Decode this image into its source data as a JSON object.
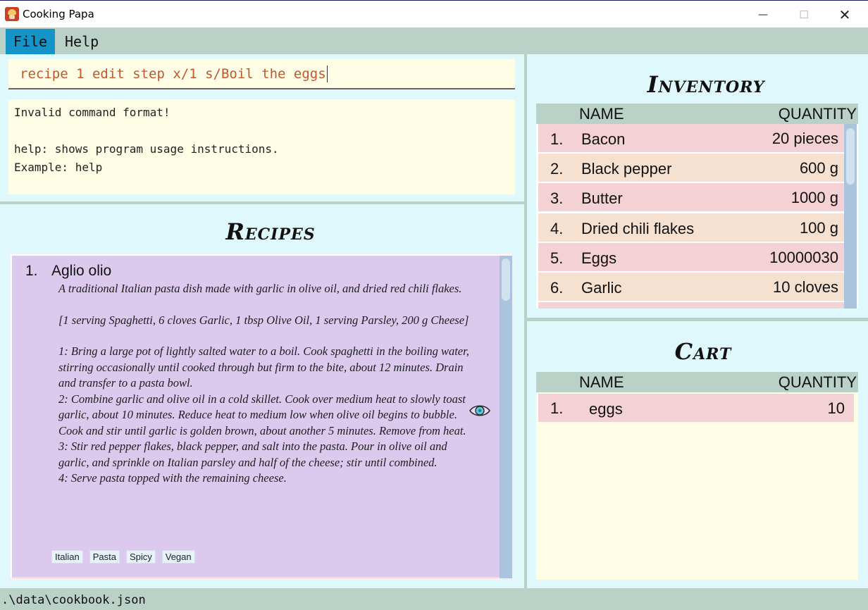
{
  "window": {
    "title": "Cooking Papa",
    "minimize_glyph": "—",
    "maximize_glyph": "☐",
    "close_glyph": "✕"
  },
  "menu": {
    "file": "File",
    "help": "Help"
  },
  "command": {
    "value": "recipe 1 edit step x/1 s/Boil the eggs"
  },
  "result": {
    "text": "Invalid command format!\n\nhelp: shows program usage instructions.\nExample: help"
  },
  "recipes": {
    "title": "Recipes",
    "items": [
      {
        "index": "1.",
        "name": "Aglio olio",
        "description": "A traditional Italian pasta dish made with garlic in olive oil, and dried red chili flakes.",
        "ingredients": "[1 serving Spaghetti, 6 cloves Garlic, 1 tbsp Olive Oil, 1 serving Parsley, 200 g Cheese]",
        "steps": [
          "1: Bring a large pot of lightly salted water to a boil. Cook spaghetti in the boiling water, stirring occasionally until cooked through but firm to the bite, about 12 minutes. Drain and transfer to a pasta bowl.",
          "2: Combine garlic and olive oil in a cold skillet. Cook over medium heat to slowly toast garlic, about 10 minutes. Reduce heat to medium low when olive oil begins to bubble. Cook and stir until garlic is golden brown, about another 5 minutes. Remove from heat.",
          "3: Stir red pepper flakes, black pepper, and salt into the pasta. Pour in olive oil and garlic, and sprinkle on Italian parsley and half of the cheese; stir until combined.",
          "4: Serve pasta topped with the remaining cheese."
        ],
        "tags": [
          "Italian",
          "Pasta",
          "Spicy",
          "Vegan"
        ],
        "icon": "eye-icon"
      }
    ]
  },
  "inventory": {
    "title": "Inventory",
    "header": {
      "name": "NAME",
      "quantity": "QUANTITY"
    },
    "rows": [
      {
        "index": "1.",
        "name": "Bacon",
        "quantity": "20 pieces"
      },
      {
        "index": "2.",
        "name": "Black pepper",
        "quantity": "600 g"
      },
      {
        "index": "3.",
        "name": "Butter",
        "quantity": "1000 g"
      },
      {
        "index": "4.",
        "name": "Dried chili flakes",
        "quantity": "100 g"
      },
      {
        "index": "5.",
        "name": "Eggs",
        "quantity": "10000030"
      },
      {
        "index": "6.",
        "name": "Garlic",
        "quantity": "10 cloves"
      }
    ]
  },
  "cart": {
    "title": "Cart",
    "header": {
      "name": "NAME",
      "quantity": "QUANTITY"
    },
    "rows": [
      {
        "index": "1.",
        "name": "eggs",
        "quantity": "10"
      }
    ]
  },
  "status": {
    "path": ".\\data\\cookbook.json"
  },
  "colors": {
    "menu_bg": "#b9d1c6",
    "menu_active": "#1594c8",
    "panel_bg": "#dff8fb",
    "input_bg": "#fffde6",
    "recipe_card": "#dcc9ee",
    "row_pink": "#f4d1d4",
    "row_peach": "#f6e1d1",
    "command_text": "#c0582c"
  }
}
